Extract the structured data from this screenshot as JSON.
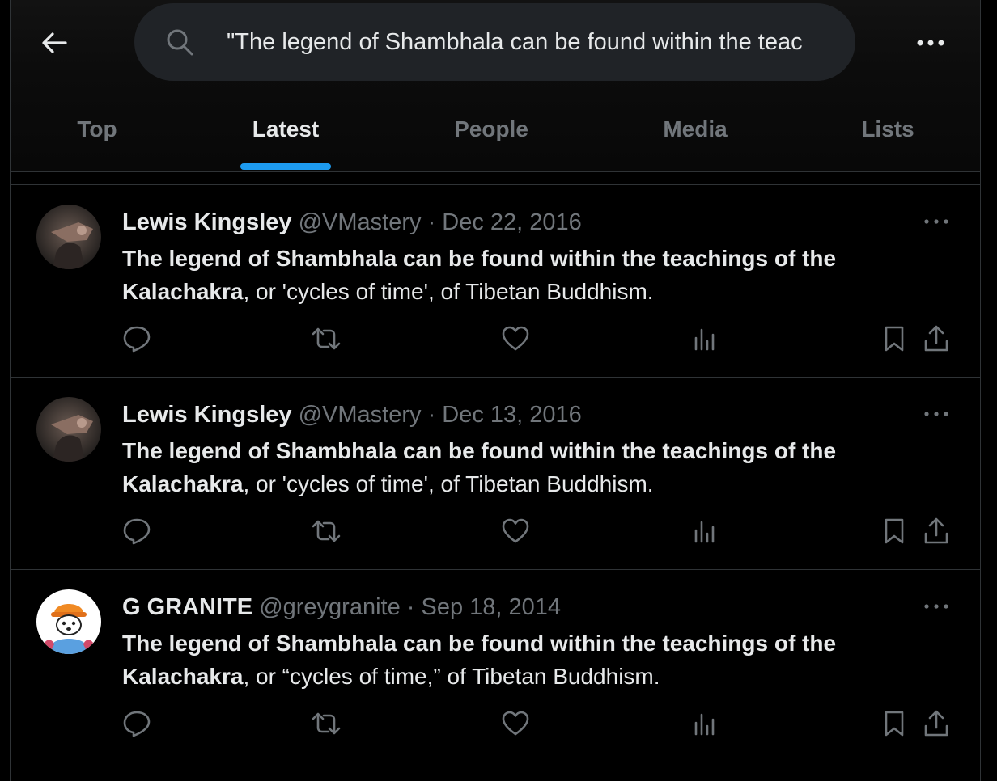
{
  "search": {
    "query": "\"The legend of Shambhala can be found within the teac"
  },
  "tabs": [
    {
      "label": "Top",
      "active": false
    },
    {
      "label": "Latest",
      "active": true
    },
    {
      "label": "People",
      "active": false
    },
    {
      "label": "Media",
      "active": false
    },
    {
      "label": "Lists",
      "active": false
    }
  ],
  "colors": {
    "accent": "#1d9bf0",
    "background": "#000000",
    "muted": "#71767b",
    "text": "#e7e9ea"
  },
  "posts": [
    {
      "name": "Lewis Kingsley",
      "handle": "@VMastery",
      "sep": "·",
      "date": "Dec 22, 2016",
      "bold_text": "The legend of Shambhala can be found within the teachings of the Kalachakra",
      "rest_text": ", or 'cycles of time', of Tibetan Buddhism.",
      "avatar": "dark-photo-avatar"
    },
    {
      "name": "Lewis Kingsley",
      "handle": "@VMastery",
      "sep": "·",
      "date": "Dec 13, 2016",
      "bold_text": "The legend of Shambhala can be found within the teachings of the Kalachakra",
      "rest_text": ", or 'cycles of time', of Tibetan Buddhism.",
      "avatar": "dark-photo-avatar"
    },
    {
      "name": "G GRANITE",
      "handle": "@greygranite",
      "sep": "·",
      "date": "Sep 18, 2014",
      "bold_text": "The legend of Shambhala can be found within the teachings of the Kalachakra",
      "rest_text": ", or “cycles of time,” of Tibetan Buddhism.",
      "avatar": "cartoon-dog-avatar"
    }
  ],
  "icons": {
    "back": "arrow-left-icon",
    "search": "search-icon",
    "more": "more-horizontal-icon",
    "reply": "reply-icon",
    "retweet": "retweet-icon",
    "like": "heart-icon",
    "views": "views-icon",
    "bookmark": "bookmark-icon",
    "share": "share-icon"
  }
}
